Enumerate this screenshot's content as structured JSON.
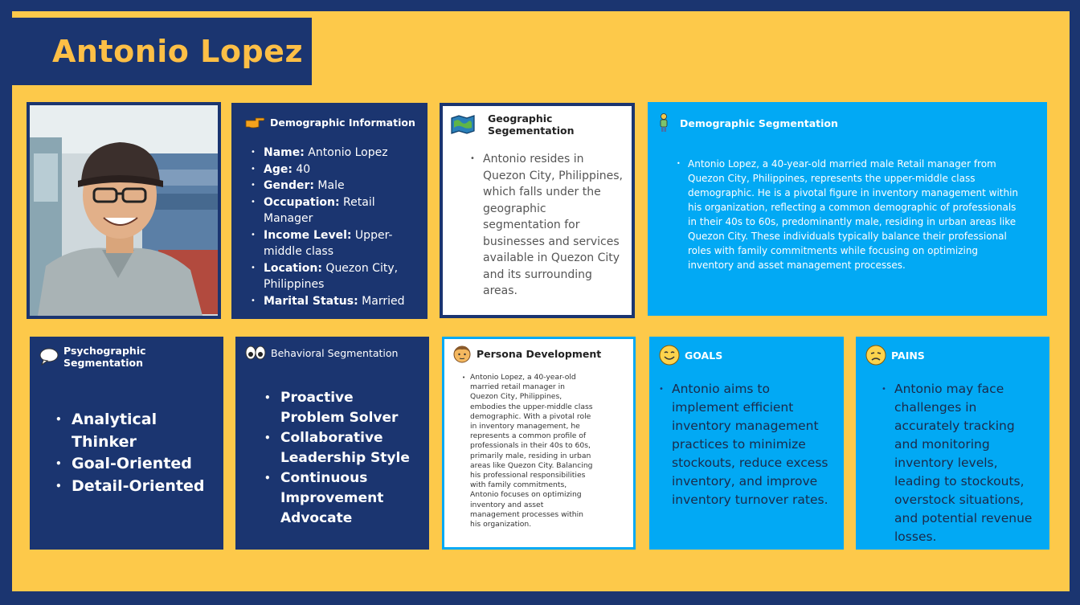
{
  "title": "Antonio Lopez",
  "photo": {
    "alt": "man-portrait"
  },
  "demographic_info": {
    "heading": "Demographic Information",
    "icon": "pointing-hand-icon",
    "items": [
      {
        "label": "Name:",
        "value": " Antonio Lopez"
      },
      {
        "label": "Age:",
        "value": " 40"
      },
      {
        "label": "Gender:",
        "value": " Male"
      },
      {
        "label": "Occupation:",
        "value": " Retail Manager"
      },
      {
        "label": "Income Level:",
        "value": " Upper-middle class"
      },
      {
        "label": "Location:",
        "value": " Quezon City, Philippines"
      },
      {
        "label": "Marital Status:",
        "value": " Married"
      }
    ]
  },
  "geographic": {
    "heading": "Geographic Segementation",
    "icon": "map-icon",
    "text": "Antonio resides in Quezon City, Philippines, which falls under the geographic segmentation for businesses and services available in Quezon City and its surrounding areas."
  },
  "demographic_segmentation": {
    "heading": "Demographic Segmentation",
    "icon": "person-icon",
    "text": "Antonio Lopez, a 40-year-old married male Retail manager from Quezon City, Philippines, represents the upper-middle class demographic. He is a  pivotal figure in inventory management within his organization, reflecting a common demographic of professionals in their 40s to 60s, predominantly male, residing in urban areas like Quezon City. These individuals typically balance their professional roles with family commitments while focusing on optimizing inventory and asset management  processes."
  },
  "psychographic": {
    "heading": "Psychographic Segmentation",
    "icon": "speech-bubble-icon",
    "items": [
      "Analytical Thinker",
      "Goal-Oriented",
      "Detail-Oriented"
    ]
  },
  "behavioral": {
    "heading": "Behavioral Segmentation",
    "icon": "eyes-icon",
    "items": [
      "Proactive Problem Solver",
      "Collaborative Leadership Style",
      "Continuous Improvement Advocate"
    ]
  },
  "persona": {
    "heading": "Persona Development",
    "icon": "face-icon",
    "text": "Antonio Lopez, a 40-year-old married retail manager in Quezon City, Philippines, embodies the upper-middle class demographic. With a pivotal  role in inventory management, he represents a common profile of  professionals in their 40s to 60s, primarily male, residing in urban  areas like Quezon City. Balancing his professional responsibilities with  family commitments, Antonio focuses on optimizing inventory and asset management processes within his organization."
  },
  "goals": {
    "heading": "GOALS",
    "icon": "smile-icon",
    "text": "Antonio aims to implement efficient inventory management practices to minimize stockouts, reduce excess inventory, and improve inventory  turnover rates."
  },
  "pains": {
    "heading": "PAINS",
    "icon": "sad-face-icon",
    "text": "Antonio may face challenges in accurately tracking and monitoring inventory levels, leading to stockouts, overstock situations, and potential revenue losses."
  },
  "colors": {
    "navy": "#1b3570",
    "gold": "#fdc94a",
    "sky": "#02a9f4",
    "title": "#fdbf46"
  }
}
